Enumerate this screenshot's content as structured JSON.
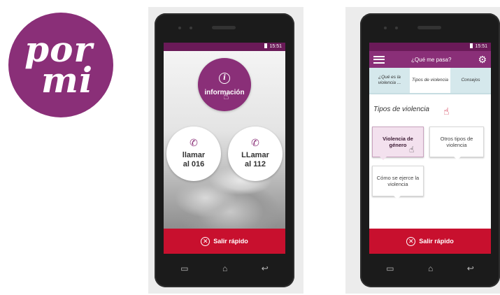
{
  "logo": {
    "line1": "por",
    "line2": "mi"
  },
  "phone1": {
    "status_time": "15:51",
    "info_button": {
      "icon": "info-icon",
      "label": "información"
    },
    "call_016": {
      "icon": "phone-icon",
      "label_line1": "llamar",
      "label_line2": "al 016"
    },
    "call_112": {
      "icon": "phone-icon",
      "label_line1": "LLamar",
      "label_line2": "al 112"
    },
    "exit_button": {
      "icon": "close-circle-icon",
      "label": "Salir rápido"
    }
  },
  "phone2": {
    "status_time": "15:51",
    "appbar_title": "¿Qué me pasa?",
    "tabs": [
      {
        "label": "¿Qué es la violencia ...",
        "active": false
      },
      {
        "label": "Tipos de violencia",
        "active": true
      },
      {
        "label": "Consejos",
        "active": false
      }
    ],
    "section_title": "Tipos de violencia",
    "cards": {
      "gender_violence": "Violencia de género",
      "other_types": "Otros tipos de violencia",
      "how_exercised": "Cómo se ejerce la violencia"
    },
    "exit_button": {
      "icon": "close-circle-icon",
      "label": "Salir rápido"
    }
  },
  "colors": {
    "brand_purple": "#8a2f78",
    "exit_red": "#c8102e",
    "tab_bg": "#d5e8ec"
  }
}
